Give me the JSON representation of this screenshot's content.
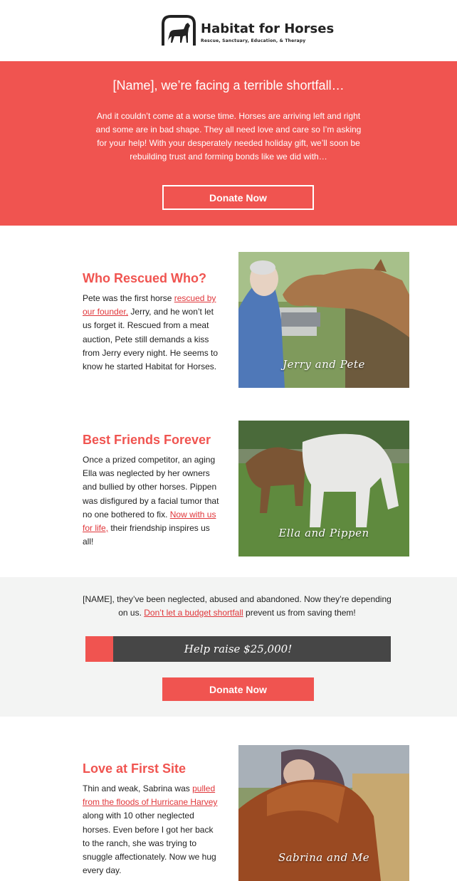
{
  "logo": {
    "name": "Habitat for Horses",
    "tagline": "Rescue, Sanctuary, Education, & Therapy"
  },
  "hero": {
    "title": "[Name], we’re facing a terrible shortfall…",
    "body": "And it couldn’t come at a worse time. Horses are arriving left and right and some are in bad shape. They all need love and care so I’m asking for your help! With your desperately needed holiday gift, we’ll soon be rebuilding trust and forming bonds like we did with…",
    "button": "Donate Now"
  },
  "stories": [
    {
      "title": "Who Rescued Who?",
      "parts": [
        "Pete was the first horse ",
        "rescued by our founder,",
        " Jerry, and he won’t let us forget it. Rescued from a meat auction, Pete still demands a kiss from Jerry every night. He seems to know he started Habitat for Horses."
      ],
      "caption": "Jerry and Pete"
    },
    {
      "title": "Best Friends Forever",
      "parts": [
        "Once a prized competitor, an aging Ella was neglected by her owners and bullied by other horses. Pippen was disfigured by a facial tumor that no one bothered to fix. ",
        "Now with us for life,",
        " their friendship inspires us all!"
      ],
      "caption": "Ella and Pippen"
    },
    {
      "title": "Love at First Site",
      "parts": [
        "Thin and weak, Sabrina was ",
        "pulled from the floods of Hurricane Harvey",
        " along with 10 other neglected horses. Even before I got her back to the ranch, she was trying to snuggle affectionately. Now we hug every day."
      ],
      "caption": "Sabrina and Me"
    }
  ],
  "appeal": {
    "parts": [
      "[NAME], they’ve been neglected, abused and abandoned. Now they’re depending on us. ",
      "Don’t let a budget shortfall",
      " prevent us from saving them!"
    ],
    "progress_label": "Help raise $25,000!",
    "progress_fraction": 0.09,
    "button": "Donate Now"
  },
  "colors": {
    "accent": "#f05450",
    "link": "#e0363a",
    "progress_track": "#464646",
    "appeal_bg": "#f3f4f3"
  }
}
